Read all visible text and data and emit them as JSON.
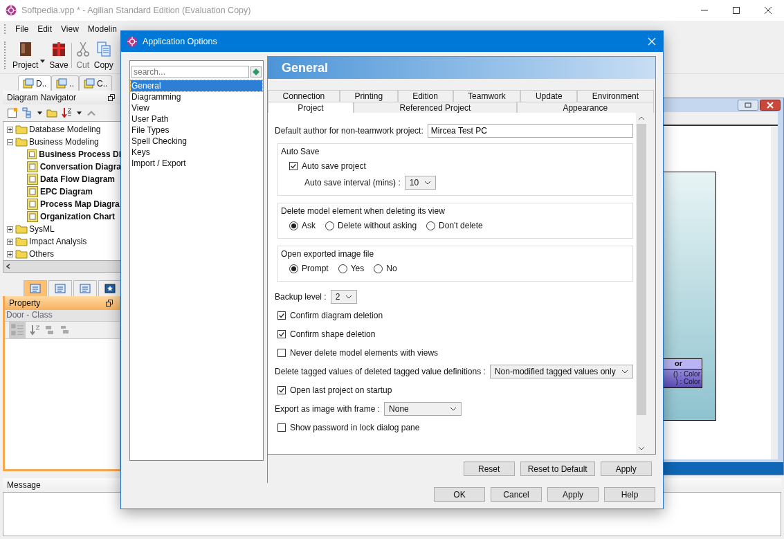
{
  "window": {
    "title": "Softpedia.vpp * - Agilian Standard Edition (Evaluation Copy)"
  },
  "menu": [
    "File",
    "Edit",
    "View",
    "Modelin"
  ],
  "toolbar": [
    {
      "kind": "project",
      "label": "Project",
      "disabled": false,
      "dropdown": true
    },
    {
      "kind": "save",
      "label": "Save",
      "disabled": false,
      "dropdown": false
    },
    {
      "kind": "cut",
      "label": "Cut",
      "disabled": true,
      "dropdown": false
    },
    {
      "kind": "copy",
      "label": "Copy",
      "disabled": false,
      "dropdown": false
    }
  ],
  "navigator_tabs": [
    {
      "label": "D..",
      "selected": true
    },
    {
      "label": "..",
      "selected": false
    },
    {
      "label": "C..",
      "selected": false
    }
  ],
  "diagram_navigator": {
    "title": "Diagram Navigator",
    "tree": [
      {
        "kind": "folder",
        "label": "Database Modeling",
        "expanded": false
      },
      {
        "kind": "folder",
        "label": "Business Modeling",
        "expanded": true,
        "children": [
          {
            "kind": "diagram",
            "label": "Business Process Di"
          },
          {
            "kind": "diagram",
            "label": "Conversation Diagra"
          },
          {
            "kind": "diagram",
            "label": "Data Flow Diagram"
          },
          {
            "kind": "diagram",
            "label": "EPC Diagram"
          },
          {
            "kind": "diagram",
            "label": "Process Map Diagra"
          },
          {
            "kind": "diagram",
            "label": "Organization Chart"
          }
        ]
      },
      {
        "kind": "folder",
        "label": "SysML",
        "expanded": false
      },
      {
        "kind": "folder",
        "label": "Impact Analysis",
        "expanded": false
      },
      {
        "kind": "folder",
        "label": "Others",
        "expanded": false
      }
    ]
  },
  "property_tabs": [
    {
      "selected": true
    },
    {
      "selected": false
    },
    {
      "selected": false
    },
    {
      "selected": false
    }
  ],
  "property": {
    "title": "Property",
    "subject": "Door - Class"
  },
  "message": {
    "title": "Message"
  },
  "diagram": {
    "class_name": "or",
    "operations": [
      "() : Color",
      ") : Color"
    ]
  },
  "dialog": {
    "title": "Application Options",
    "search": {
      "placeholder": "search..."
    },
    "categories": [
      {
        "label": "General",
        "selected": true
      },
      {
        "label": "Diagramming",
        "selected": false
      },
      {
        "label": "View",
        "selected": false
      },
      {
        "label": "User Path",
        "selected": false
      },
      {
        "label": "File Types",
        "selected": false
      },
      {
        "label": "Spell Checking",
        "selected": false
      },
      {
        "label": "Keys",
        "selected": false
      },
      {
        "label": "Import / Export",
        "selected": false
      }
    ],
    "header": "General",
    "tabs_row_1": [
      {
        "label": "Connection",
        "selected": false
      },
      {
        "label": "Printing",
        "selected": false
      },
      {
        "label": "Edition",
        "selected": false
      },
      {
        "label": "Teamwork",
        "selected": false
      },
      {
        "label": "Update",
        "selected": false
      },
      {
        "label": "Environment",
        "selected": false
      }
    ],
    "tabs_row_2": [
      {
        "label": "Project",
        "selected": true
      },
      {
        "label": "Referenced Project",
        "selected": false
      },
      {
        "label": "Appearance",
        "selected": false
      }
    ],
    "fields": [
      {
        "kind": "text",
        "label": "Default author for non-teamwork project:",
        "value": "Mircea Test PC"
      },
      {
        "kind": "group",
        "title": "Auto Save",
        "items": [
          {
            "kind": "checkbox",
            "label": "Auto save project",
            "checked": true
          },
          {
            "kind": "select",
            "label": "Auto save interval (mins) :",
            "value": "10"
          }
        ]
      },
      {
        "kind": "group",
        "title": "Delete model element when deleting its view",
        "items": [
          {
            "kind": "radios",
            "options": [
              {
                "label": "Ask",
                "selected": true
              },
              {
                "label": "Delete without asking",
                "selected": false
              },
              {
                "label": "Don't delete",
                "selected": false
              }
            ]
          }
        ]
      },
      {
        "kind": "group",
        "title": "Open exported image file",
        "items": [
          {
            "kind": "radios",
            "options": [
              {
                "label": "Prompt",
                "selected": true
              },
              {
                "label": "Yes",
                "selected": false
              },
              {
                "label": "No",
                "selected": false
              }
            ]
          }
        ]
      },
      {
        "kind": "select",
        "label": "Backup level :",
        "value": "2"
      },
      {
        "kind": "checkbox",
        "label": "Confirm diagram deletion",
        "checked": true
      },
      {
        "kind": "checkbox",
        "label": "Confirm shape deletion",
        "checked": true
      },
      {
        "kind": "checkbox",
        "label": "Never delete model elements with views",
        "checked": false
      },
      {
        "kind": "select",
        "label": "Delete tagged values of deleted tagged value definitions :",
        "value": "Non-modified tagged values only"
      },
      {
        "kind": "checkbox",
        "label": "Open last project on startup",
        "checked": true
      },
      {
        "kind": "select",
        "label": "Export as image with frame :",
        "value": "None"
      },
      {
        "kind": "checkbox",
        "label": "Show password in lock dialog pane",
        "checked": false
      }
    ],
    "page_buttons": [
      "Reset",
      "Reset to Default",
      "Apply"
    ],
    "buttons": [
      "OK",
      "Cancel",
      "Apply",
      "Help"
    ]
  }
}
